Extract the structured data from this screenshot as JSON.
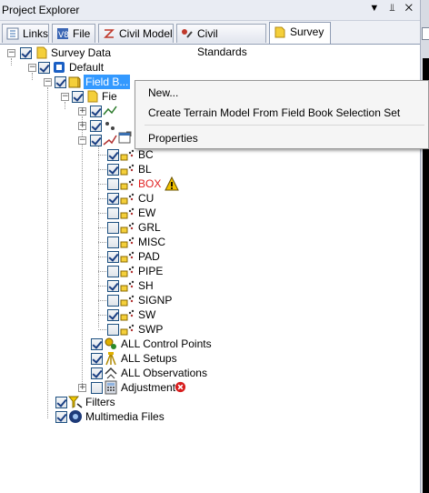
{
  "window": {
    "title": "Project Explorer",
    "pin_glyphs": "▼ ⫫ ✕"
  },
  "tabs": [
    {
      "label": "Links",
      "icon": "links-icon"
    },
    {
      "label": "File",
      "icon": "file-icon"
    },
    {
      "label": "Civil Model",
      "icon": "civil-model-icon"
    },
    {
      "label": "Civil Standards",
      "icon": "civil-standards-icon"
    },
    {
      "label": "Survey",
      "icon": "survey-folder-icon",
      "active": true
    }
  ],
  "tree": {
    "survey_data": "Survey Data",
    "default": "Default",
    "field_book": "Field B...",
    "field_sub": "Fie",
    "codes": [
      {
        "label": "BC",
        "checked": true
      },
      {
        "label": "BL",
        "checked": true
      },
      {
        "label": "BOX",
        "checked": false,
        "warning": true,
        "color": "#e02020"
      },
      {
        "label": "CU",
        "checked": true
      },
      {
        "label": "EW",
        "checked": false
      },
      {
        "label": "GRL",
        "checked": false
      },
      {
        "label": "MISC",
        "checked": false
      },
      {
        "label": "PAD",
        "checked": true
      },
      {
        "label": "PIPE",
        "checked": false
      },
      {
        "label": "SH",
        "checked": true
      },
      {
        "label": "SIGNP",
        "checked": false
      },
      {
        "label": "SW",
        "checked": true
      },
      {
        "label": "SWP",
        "checked": false
      }
    ],
    "all_control_points": "ALL Control Points",
    "all_setups": "ALL Setups",
    "all_observations": "ALL Observations",
    "adjustment": "Adjustment",
    "filters": "Filters",
    "multimedia": "Multimedia Files"
  },
  "context_menu": {
    "new": "New...",
    "create_terrain": "Create Terrain Model From Field Book Selection Set",
    "properties": "Properties"
  },
  "colors": {
    "accent": "#3399ff",
    "warning": "#f2c200",
    "error": "#d81e1e",
    "error_text": "#e02020"
  }
}
